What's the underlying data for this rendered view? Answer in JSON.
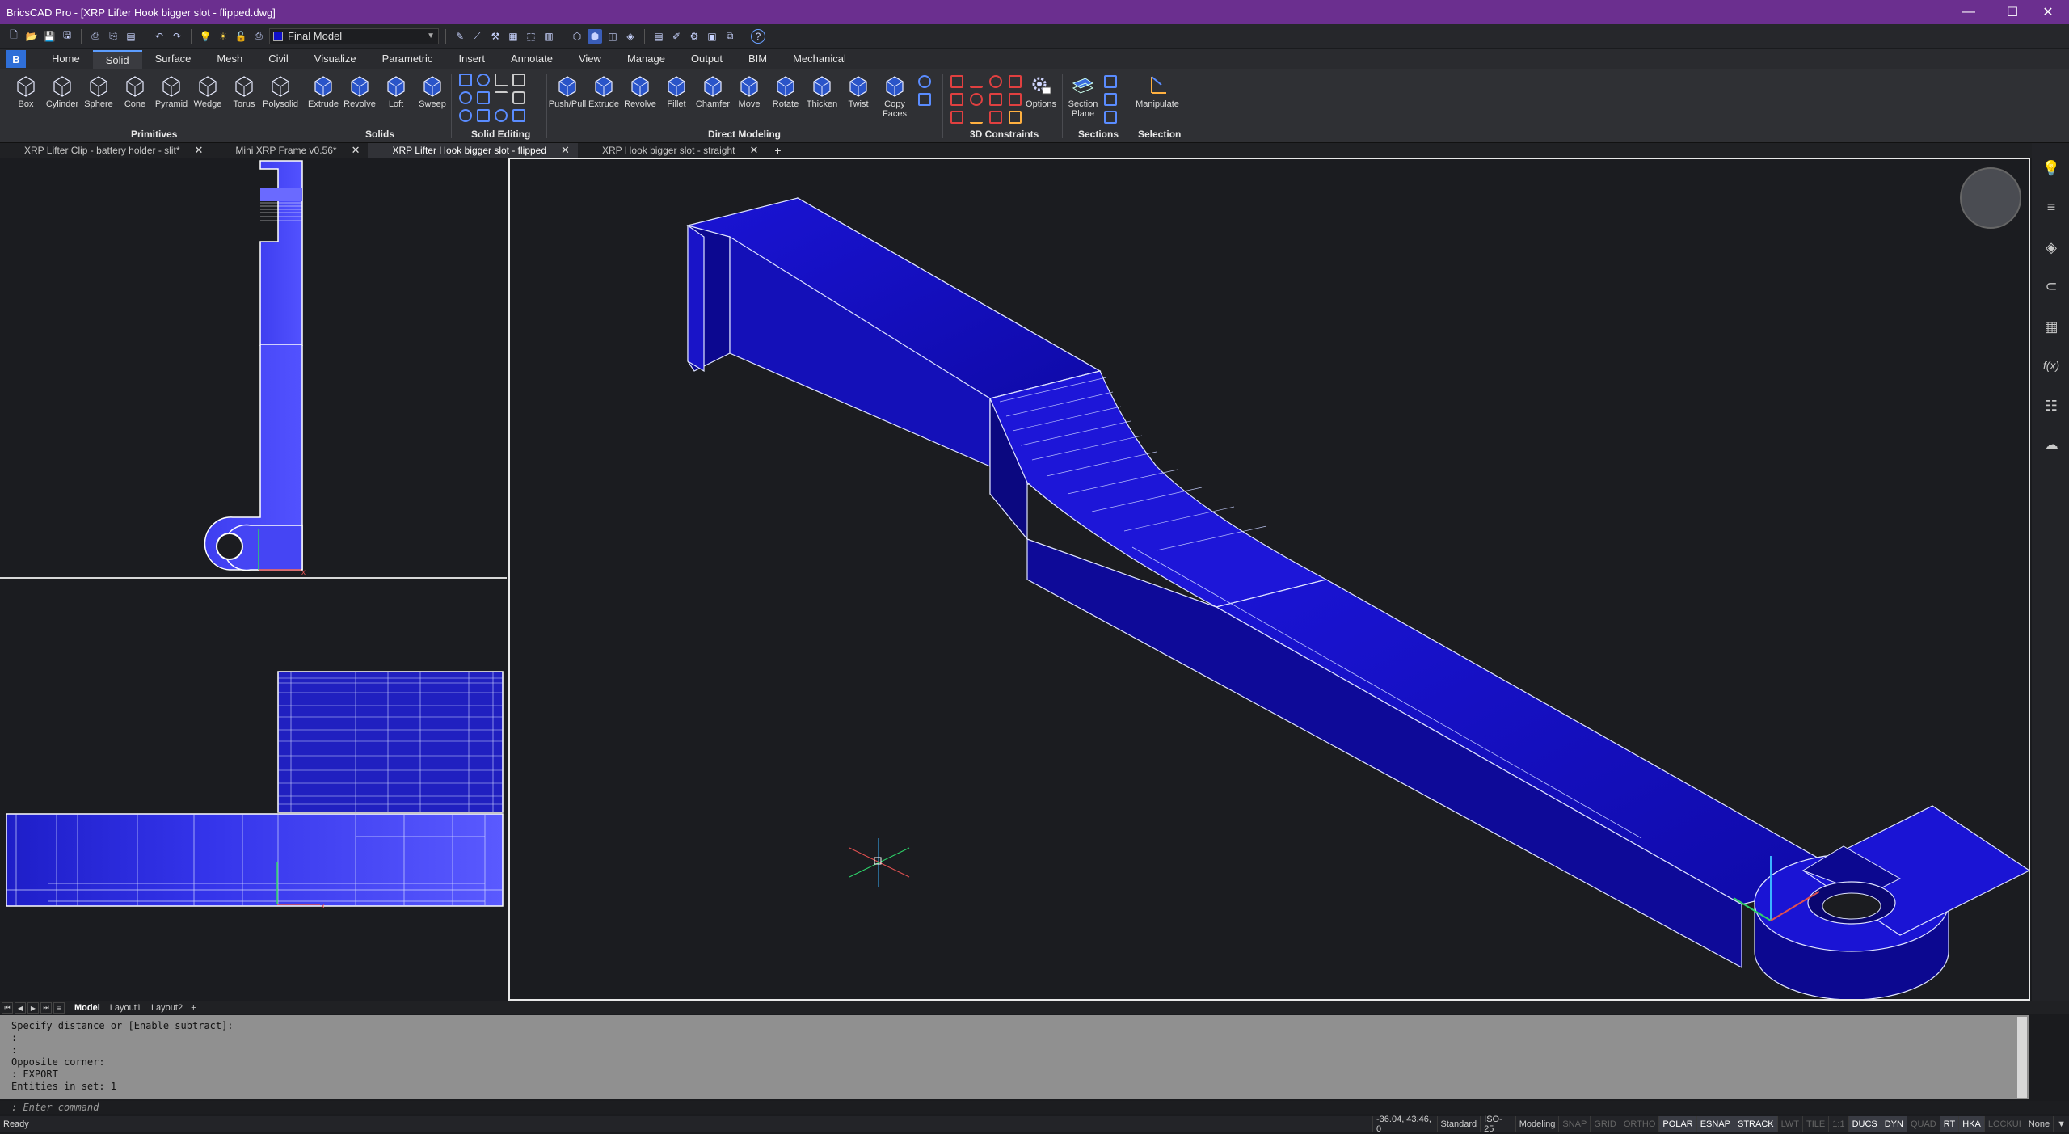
{
  "window": {
    "title": "BricsCAD Pro - [XRP Lifter Hook bigger slot - flipped.dwg]",
    "minimize": "—",
    "maximize": "☐",
    "close": "✕"
  },
  "quick_access": {
    "visual_style": "Final Model"
  },
  "ribbon": {
    "app_button": "B",
    "tabs": [
      "Home",
      "Solid",
      "Surface",
      "Mesh",
      "Civil",
      "Visualize",
      "Parametric",
      "Insert",
      "Annotate",
      "View",
      "Manage",
      "Output",
      "BIM",
      "Mechanical"
    ],
    "active_tab": "Solid",
    "primitives": {
      "title": "Primitives",
      "buttons": [
        "Box",
        "Cylinder",
        "Sphere",
        "Cone",
        "Pyramid",
        "Wedge",
        "Torus",
        "Polysolid"
      ]
    },
    "solids": {
      "title": "Solids",
      "buttons": [
        "Extrude",
        "Revolve",
        "Loft",
        "Sweep"
      ]
    },
    "solid_editing": {
      "title": "Solid Editing"
    },
    "direct_modeling": {
      "title": "Direct Modeling",
      "buttons": [
        "Push/Pull",
        "Extrude",
        "Revolve",
        "Fillet",
        "Chamfer",
        "Move",
        "Rotate",
        "Thicken",
        "Twist",
        "Copy Faces"
      ]
    },
    "constraints": {
      "title": "3D Constraints",
      "options_label": "Options"
    },
    "sections": {
      "title": "Sections",
      "section_plane": "Section Plane"
    },
    "selection": {
      "title": "Selection",
      "manipulate": "Manipulate"
    }
  },
  "doc_tabs": [
    {
      "label": "XRP Lifter Clip - battery holder - slit*",
      "active": false
    },
    {
      "label": "Mini XRP Frame v0.56*",
      "active": false
    },
    {
      "label": "XRP Lifter Hook bigger slot - flipped",
      "active": true
    },
    {
      "label": "XRP Hook bigger slot - straight",
      "active": false
    }
  ],
  "doc_tab_add": "+",
  "layout_tabs": [
    "Model",
    "Layout1",
    "Layout2"
  ],
  "layout_tab_add": "+",
  "command": {
    "history": [
      "Specify distance or [Enable subtract]:",
      ":",
      ":",
      "Opposite corner:",
      ": EXPORT",
      "Entities in set: 1"
    ],
    "prompt": ": Enter command"
  },
  "status": {
    "ready": "Ready",
    "coords": "-36.04, 43.46, 0",
    "text_style": "Standard",
    "dim_style": "ISO-25",
    "workspace": "Modeling",
    "toggles": [
      {
        "label": "SNAP",
        "on": false
      },
      {
        "label": "GRID",
        "on": false
      },
      {
        "label": "ORTHO",
        "on": false
      },
      {
        "label": "POLAR",
        "on": true
      },
      {
        "label": "ESNAP",
        "on": true
      },
      {
        "label": "STRACK",
        "on": true
      },
      {
        "label": "LWT",
        "on": false
      },
      {
        "label": "TILE",
        "on": false
      },
      {
        "label": "1:1",
        "on": false
      },
      {
        "label": "DUCS",
        "on": true
      },
      {
        "label": "DYN",
        "on": true
      },
      {
        "label": "QUAD",
        "on": false
      },
      {
        "label": "RT",
        "on": true
      },
      {
        "label": "HKA",
        "on": true
      },
      {
        "label": "LOCKUI",
        "on": false
      }
    ],
    "none": "None"
  },
  "right_bar_icons": [
    "lightbulb-icon",
    "sliders-icon",
    "layers-icon",
    "attach-icon",
    "hatch-icon",
    "fx-icon",
    "structure-icon",
    "cloud-icon"
  ],
  "colors": {
    "titlebar": "#6b2f8f",
    "part_blue": "#1a14c8"
  }
}
